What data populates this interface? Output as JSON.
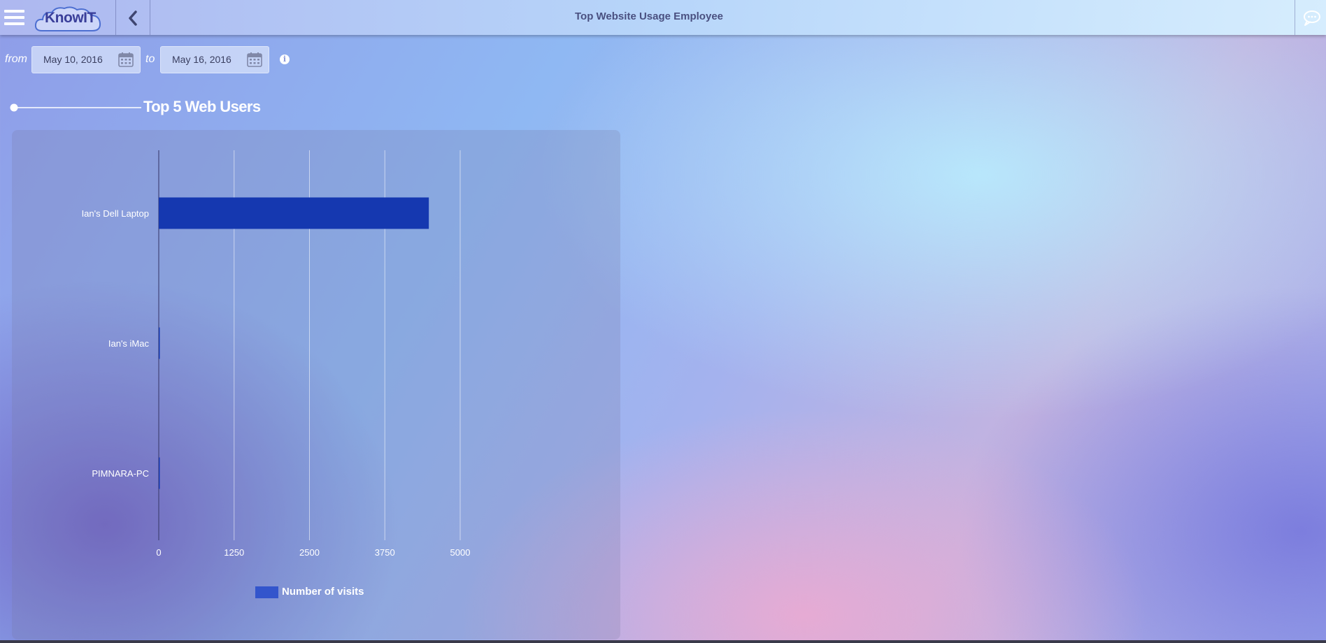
{
  "header": {
    "logo_text": "KnowIT",
    "title": "Top Website Usage Employee"
  },
  "filters": {
    "from_label": "from",
    "from_date": "May 10, 2016",
    "to_label": "to",
    "to_date": "May 16, 2016",
    "info_glyph": "i"
  },
  "section": {
    "title": "Top 5 Web Users"
  },
  "icons": {
    "menu": "hamburger-menu-icon",
    "back": "chevron-left-icon",
    "chat": "chat-bubble-icon",
    "calendar": "calendar-icon",
    "info": "info-icon"
  },
  "colors": {
    "bar": "#1538b0",
    "legend": "#3355cc"
  },
  "chart_data": {
    "type": "bar",
    "orientation": "horizontal",
    "categories": [
      "Ian's Dell Laptop",
      "Ian's iMac",
      "PIMNARA-PC"
    ],
    "series": [
      {
        "name": "Number of visits",
        "values": [
          4480,
          15,
          10
        ]
      }
    ],
    "xlim": [
      0,
      5000
    ],
    "xticks": [
      "0",
      "1250",
      "2500",
      "3750",
      "5000"
    ],
    "grid": true,
    "legend": "bottom-center"
  }
}
